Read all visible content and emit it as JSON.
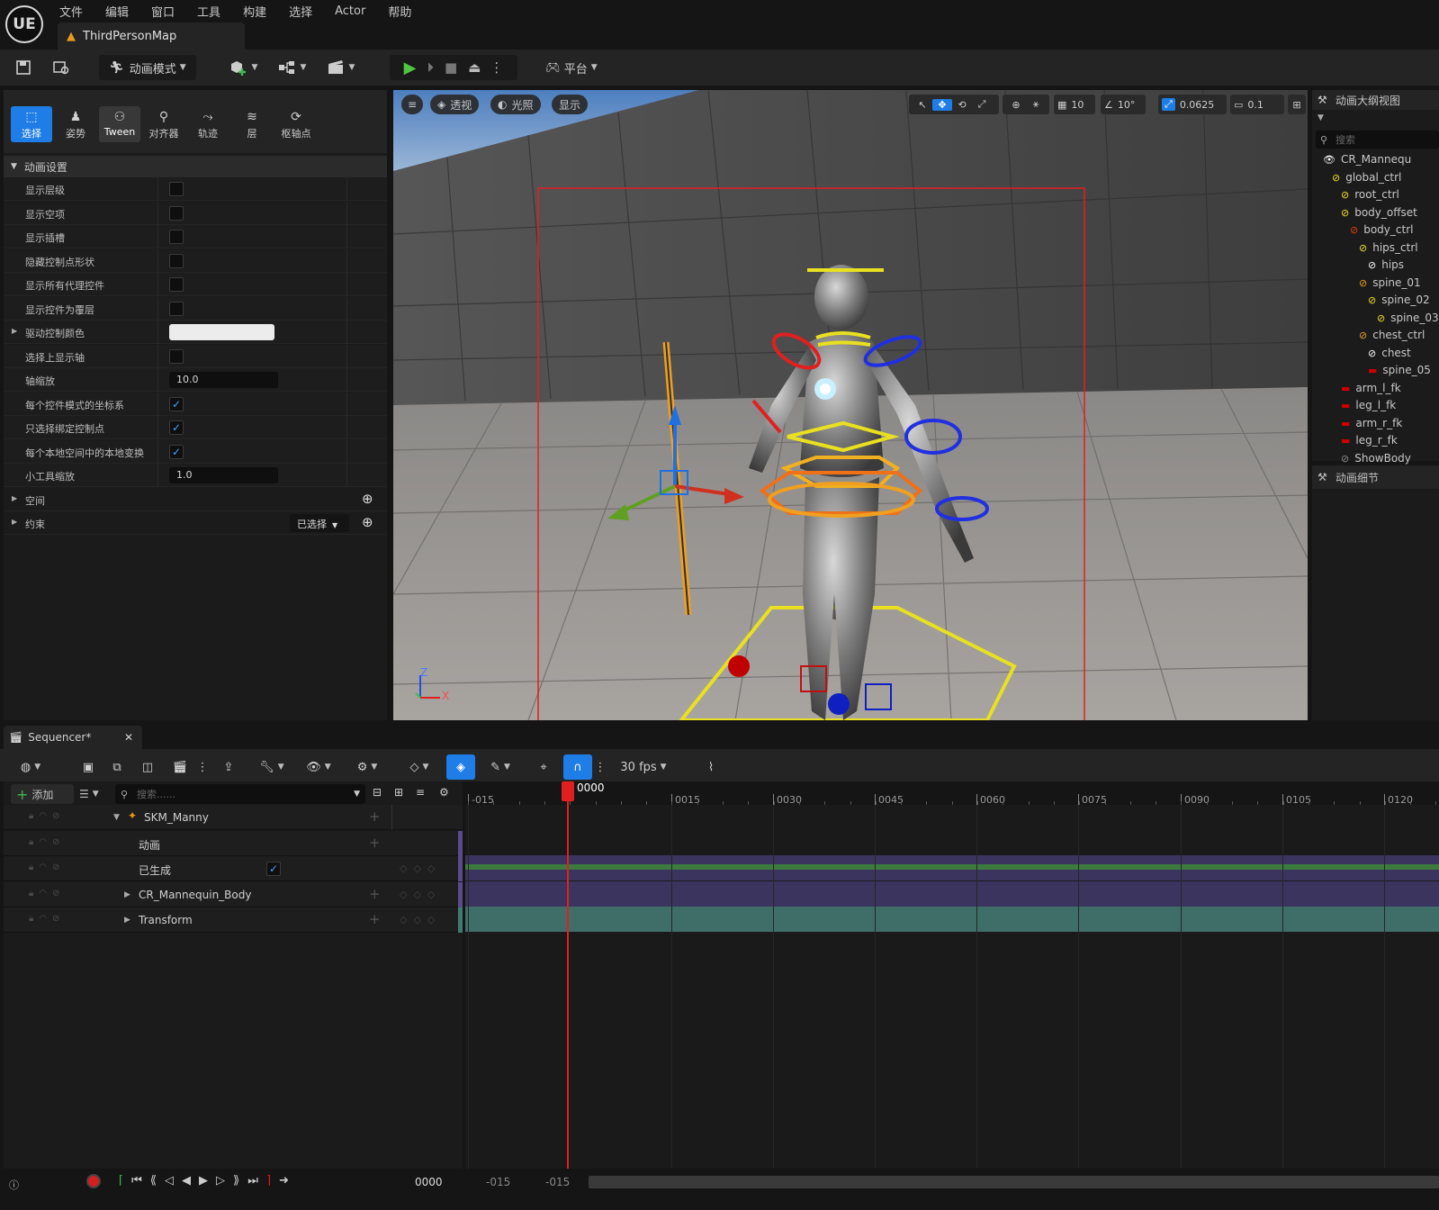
{
  "app": {
    "logo": "UE",
    "menu": [
      "文件",
      "编辑",
      "窗口",
      "工具",
      "构建",
      "选择",
      "Actor",
      "帮助"
    ],
    "map_tab": "ThirdPersonMap"
  },
  "toolbar": {
    "mode_label": "动画模式",
    "platform_label": "平台"
  },
  "mode_tabs": [
    {
      "label": "选择",
      "icon": "select-icon"
    },
    {
      "label": "姿势",
      "icon": "pose-icon"
    },
    {
      "label": "Tween",
      "icon": "tween-icon"
    },
    {
      "label": "对齐器",
      "icon": "snapper-icon"
    },
    {
      "label": "轨迹",
      "icon": "trails-icon"
    },
    {
      "label": "层",
      "icon": "layers-icon"
    },
    {
      "label": "枢轴点",
      "icon": "pivot-icon"
    }
  ],
  "anim_settings": {
    "section_title": "动画设置",
    "rows": [
      {
        "label": "显示层级",
        "type": "checkbox",
        "checked": false
      },
      {
        "label": "显示空项",
        "type": "checkbox",
        "checked": false
      },
      {
        "label": "显示插槽",
        "type": "checkbox",
        "checked": false
      },
      {
        "label": "隐藏控制点形状",
        "type": "checkbox",
        "checked": false
      },
      {
        "label": "显示所有代理控件",
        "type": "checkbox",
        "checked": false
      },
      {
        "label": "显示控件为覆层",
        "type": "checkbox",
        "checked": false
      },
      {
        "label": "驱动控制颜色",
        "type": "color",
        "expandable": true
      },
      {
        "label": "选择上显示轴",
        "type": "checkbox",
        "checked": false
      },
      {
        "label": "轴缩放",
        "type": "number",
        "value": "10.0"
      },
      {
        "label": "每个控件模式的坐标系",
        "type": "checkbox",
        "checked": true
      },
      {
        "label": "只选择绑定控制点",
        "type": "checkbox",
        "checked": true
      },
      {
        "label": "每个本地空间中的本地变换",
        "type": "checkbox",
        "checked": true
      },
      {
        "label": "小工具缩放",
        "type": "number",
        "value": "1.0"
      }
    ],
    "space_label": "空间",
    "constraint_label": "约束",
    "constraint_dropdown": "已选择"
  },
  "viewport": {
    "menu_icon": "hamburger-icon",
    "perspective": "透视",
    "lit": "光照",
    "show": "显示",
    "grid_snap": "10",
    "rotation_snap": "10°",
    "scale_snap": "0.0625",
    "camera_speed": "0.1",
    "axis_labels": [
      "Z",
      "X"
    ]
  },
  "outliner": {
    "title": "动画大纲视图",
    "search_placeholder": "搜索",
    "items": [
      {
        "label": "CR_Mannequ",
        "depth": 0,
        "color": "#ffffff",
        "icon": "eye-icon"
      },
      {
        "label": "global_ctrl",
        "depth": 1,
        "color": "#f0e020"
      },
      {
        "label": "root_ctrl",
        "depth": 2,
        "color": "#f0e020"
      },
      {
        "label": "body_offset",
        "depth": 2,
        "color": "#f0e020"
      },
      {
        "label": "body_ctrl",
        "depth": 3,
        "color": "#e04010"
      },
      {
        "label": "hips_ctrl",
        "depth": 4,
        "color": "#f0e020"
      },
      {
        "label": "hips",
        "depth": 5,
        "color": "#ffffff"
      },
      {
        "label": "spine_01",
        "depth": 4,
        "color": "#f0a020"
      },
      {
        "label": "spine_02",
        "depth": 5,
        "color": "#f0e020"
      },
      {
        "label": "spine_03",
        "depth": 6,
        "color": "#f0e020"
      },
      {
        "label": "chest_ctrl",
        "depth": 4,
        "color": "#f0a020"
      },
      {
        "label": "chest",
        "depth": 5,
        "color": "#ffffff"
      },
      {
        "label": "spine_05",
        "depth": 5,
        "color": "#cc0000"
      },
      {
        "label": "arm_l_fk",
        "depth": 2,
        "color": "#cc0000"
      },
      {
        "label": "leg_l_fk",
        "depth": 2,
        "color": "#cc0000"
      },
      {
        "label": "arm_r_fk",
        "depth": 2,
        "color": "#cc0000"
      },
      {
        "label": "leg_r_fk",
        "depth": 2,
        "color": "#cc0000"
      },
      {
        "label": "ShowBody",
        "depth": 2,
        "color": "#888888"
      }
    ]
  },
  "details": {
    "title": "动画细节"
  },
  "sequencer": {
    "tab_label": "Sequencer*",
    "fps": "30 fps",
    "add_label": "添加",
    "search_placeholder": "搜索......",
    "tracks": [
      {
        "name": "SKM_Manny",
        "depth": 0,
        "expanded": true,
        "icon": "skeleton-icon"
      },
      {
        "name": "动画",
        "depth": 1
      },
      {
        "name": "已生成",
        "depth": 1,
        "checkbox": true
      },
      {
        "name": "CR_Mannequin_Body",
        "depth": 1,
        "expandable": true
      },
      {
        "name": "Transform",
        "depth": 1,
        "expandable": true
      }
    ],
    "ruler_labels": [
      "-015",
      "0015",
      "0030",
      "0045",
      "0060",
      "0075",
      "0090",
      "0105",
      "0120"
    ],
    "playhead_label": "0000",
    "current_frame": "0000",
    "range_start": "-015",
    "range_end": "-015"
  }
}
